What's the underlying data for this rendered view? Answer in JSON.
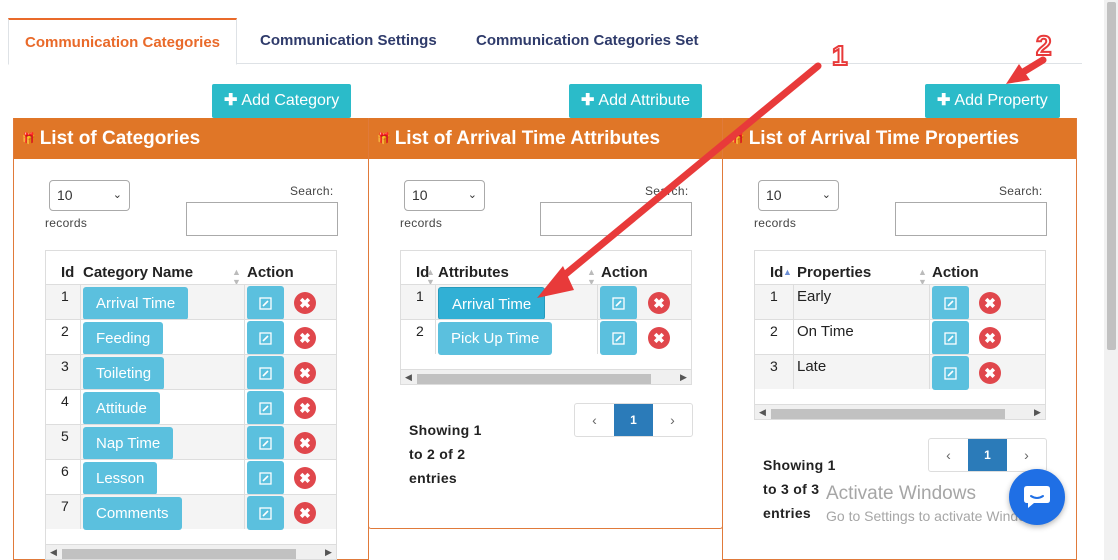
{
  "tabs": [
    {
      "label": "Communication Categories",
      "active": true
    },
    {
      "label": "Communication Settings",
      "active": false
    },
    {
      "label": "Communication Categories Set",
      "active": false
    }
  ],
  "add_buttons": {
    "category": "Add Category",
    "attribute": "Add Attribute",
    "property": "Add Property"
  },
  "panels": {
    "categories": {
      "title": "List of Categories",
      "page_size": "10",
      "records_label": "records",
      "search_label": "Search:",
      "columns": [
        "Id",
        "Category Name",
        "Action"
      ],
      "rows": [
        {
          "id": "1",
          "name": "Arrival Time"
        },
        {
          "id": "2",
          "name": "Feeding"
        },
        {
          "id": "3",
          "name": "Toileting"
        },
        {
          "id": "4",
          "name": "Attitude"
        },
        {
          "id": "5",
          "name": "Nap Time"
        },
        {
          "id": "6",
          "name": "Lesson"
        },
        {
          "id": "7",
          "name": "Comments"
        }
      ]
    },
    "attributes": {
      "title": "List of Arrival Time Attributes",
      "page_size": "10",
      "records_label": "records",
      "search_label": "Search:",
      "columns": [
        "Id",
        "Attributes",
        "Action"
      ],
      "rows": [
        {
          "id": "1",
          "name": "Arrival Time",
          "selected": true
        },
        {
          "id": "2",
          "name": "Pick Up Time",
          "selected": false
        }
      ],
      "showing": [
        "Showing 1",
        "to 2 of 2",
        "entries"
      ],
      "pager": {
        "prev": "‹",
        "current": "1",
        "next": "›"
      }
    },
    "properties": {
      "title": "List of Arrival Time Properties",
      "page_size": "10",
      "records_label": "records",
      "search_label": "Search:",
      "columns": [
        "Id",
        "Properties",
        "Action"
      ],
      "rows": [
        {
          "id": "1",
          "name": "Early"
        },
        {
          "id": "2",
          "name": "On Time"
        },
        {
          "id": "3",
          "name": "Late"
        }
      ],
      "showing": [
        "Showing 1",
        "to 3 of 3",
        "entries"
      ],
      "pager": {
        "prev": "‹",
        "current": "1",
        "next": "›"
      }
    }
  },
  "watermark": {
    "line1": "Activate Windows",
    "line2": "Go to Settings to activate Windows."
  },
  "annotations": {
    "one": "1",
    "two": "2",
    "color": "#e83a3a"
  },
  "colors": {
    "accent_tab": "#e96a2a",
    "panel_header": "#e07627",
    "add_button": "#2bbbc9",
    "pill": "#5bc0de",
    "delete": "#e0474c",
    "pager_active": "#2b7bb9"
  }
}
